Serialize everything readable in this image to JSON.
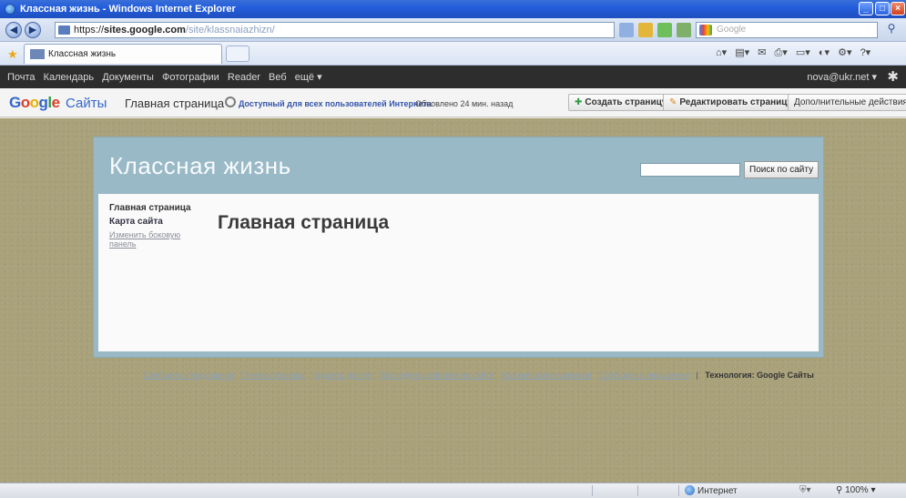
{
  "window": {
    "title": "Классная жизнь - Windows Internet Explorer"
  },
  "address": {
    "url_prefix": "https://",
    "url_host": "sites.google.com",
    "url_path": "/site/klassnaiazhizn/",
    "search_placeholder": "Google"
  },
  "tabs": [
    {
      "label": "Классная жизнь"
    }
  ],
  "google_bar": {
    "links": [
      "Почта",
      "Календарь",
      "Документы",
      "Фотографии",
      "Reader",
      "Веб",
      "ещё ▾"
    ],
    "account": "nova@ukr.net ▾"
  },
  "sites_header": {
    "logo_parts": [
      "G",
      "o",
      "o",
      "g",
      "l",
      "e"
    ],
    "product": "Сайты",
    "page_name": "Главная страница",
    "share_status": "Доступный для всех пользователей Интернета",
    "updated": "Обновлено 24 мин. назад",
    "create_page": "Создать страницу",
    "edit_page": "Редактировать страницу",
    "more_actions": "Дополнительные действия ▾"
  },
  "site": {
    "title": "Классная жизнь",
    "search_button": "Поиск по сайту",
    "nav": [
      {
        "label": "Главная страница"
      },
      {
        "label": "Карта сайта"
      }
    ],
    "edit_sidebar": "Изменить боковую панель",
    "heading": "Главная страница"
  },
  "footer": {
    "links": [
      "Сообщить о нарушении",
      "Печать страницы",
      "Удалить доступ",
      "Последние действия на сайте",
      "Условия использования",
      "Сообщить о нарушении"
    ],
    "powered_by": "Технология: Google Сайты"
  },
  "status": {
    "zone": "Интернет",
    "zoom": "100%"
  },
  "colors": {
    "canvas": "#a9a17a",
    "site_frame": "#9ab9c6",
    "gbar": "#2d2d2d"
  }
}
